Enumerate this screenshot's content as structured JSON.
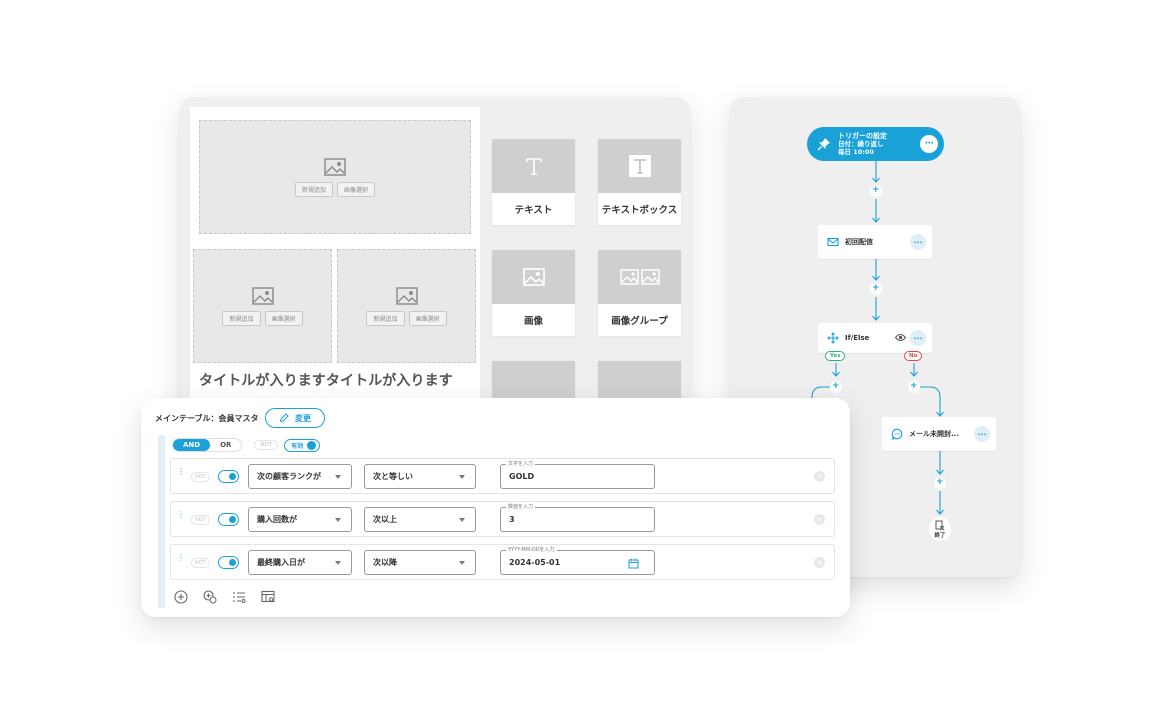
{
  "editor": {
    "placeholder_new": "新規追加",
    "placeholder_select": "画像選択",
    "page_title": "タイトルが入りますタイトルが入ります",
    "components": [
      {
        "label": "テキスト",
        "icon": "text-icon"
      },
      {
        "label": "テキストボックス",
        "icon": "textbox-icon"
      },
      {
        "label": "画像",
        "icon": "image-icon"
      },
      {
        "label": "画像グループ",
        "icon": "image-group-icon"
      }
    ]
  },
  "flow": {
    "trigger": {
      "title": "トリガーの設定",
      "line1": "日付：繰り返し",
      "line2": "毎日  10:00"
    },
    "first_delivery": "初回配信",
    "ifelse": "If/Else",
    "yes": "Yes",
    "no": "No",
    "unopened": "メール未開封...",
    "end": "終了",
    "add": "+",
    "accent": "#1aa1d8"
  },
  "condition": {
    "table_label": "メインテーブル：会員マスタ",
    "change_label": "変更",
    "and": "AND",
    "or": "OR",
    "not": "NOT",
    "valid": "有効",
    "rows": [
      {
        "field": "次の顧客ランクが",
        "op": "次と等しい",
        "legend": "文字を入力",
        "value": "GOLD"
      },
      {
        "field": "購入回数が",
        "op": "次以上",
        "legend": "数値を入力",
        "value": "3"
      },
      {
        "field": "最終購入日が",
        "op": "次以降",
        "legend": "YYYY-MM-DDを入力",
        "value": "2024-05-01"
      }
    ]
  }
}
